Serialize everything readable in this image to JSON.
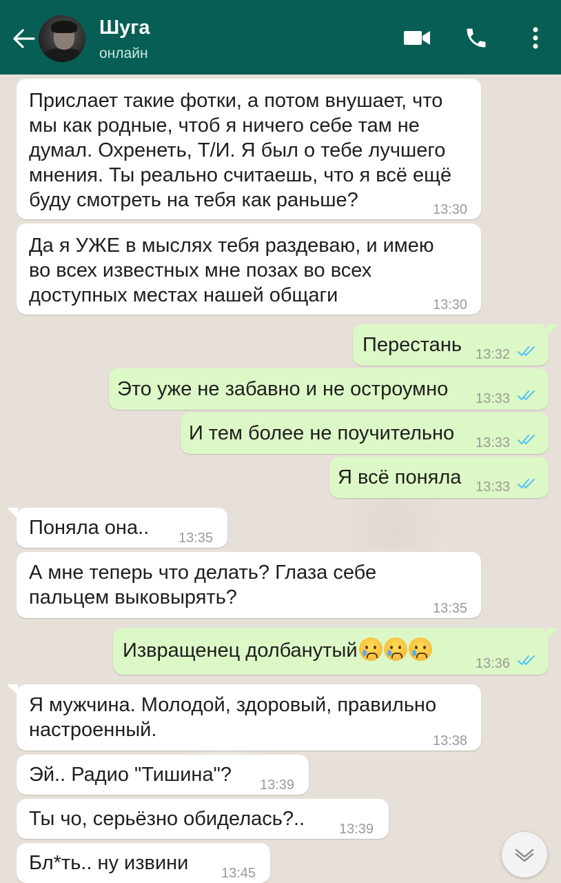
{
  "header": {
    "contact_name": "Шуга",
    "contact_status": "онлайн",
    "bg_color": "#075e54",
    "icons": [
      "back-arrow-icon",
      "video-call-icon",
      "phone-icon",
      "more-vert-icon"
    ]
  },
  "messages": [
    {
      "dir": "in",
      "text": "Прислает такие фотки, а потом внушает, что\nмы как родные, чтоб я ничего себе там не\nдумал. Охренеть, Т/И. Я был о тебе лучшего\nмнения. Ты реально считаешь, что я всё ещё\nбуду смотреть на тебя как раньше?",
      "time": "13:30"
    },
    {
      "dir": "in",
      "text": "Да я УЖЕ в мыслях тебя раздеваю, и имею\nво всех известных мне позах во всех\nдоступных местах нашей общаги",
      "time": "13:30"
    },
    {
      "dir": "out",
      "text": "Перестань",
      "time": "13:32",
      "status": "read"
    },
    {
      "dir": "out",
      "text": "Это уже не забавно и не остроумно",
      "time": "13:33",
      "status": "read"
    },
    {
      "dir": "out",
      "text": "И тем более не поучительно",
      "time": "13:33",
      "status": "read"
    },
    {
      "dir": "out",
      "text": "Я всё поняла",
      "time": "13:33",
      "status": "read"
    },
    {
      "dir": "in",
      "text": "Поняла она..",
      "time": "13:35"
    },
    {
      "dir": "in",
      "text": "А мне теперь что делать? Глаза себе\nпальцем выковырять?",
      "time": "13:35"
    },
    {
      "dir": "out",
      "text": "Извращенец долбанутый",
      "emoji": [
        "crying-face-emoji",
        "crying-face-emoji",
        "crying-face-emoji"
      ],
      "time": "13:36",
      "status": "read"
    },
    {
      "dir": "in",
      "text": "Я мужчина. Молодой, здоровый, правильно\nнастроенный.",
      "time": "13:38"
    },
    {
      "dir": "in",
      "text": "Эй.. Радио \"Тишина\"?",
      "time": "13:39"
    },
    {
      "dir": "in",
      "text": "Ты чо, серьёзно обиделась?..",
      "time": "13:39"
    },
    {
      "dir": "in",
      "text": "Бл*ть.. ну извини",
      "time": "13:45"
    }
  ],
  "colors": {
    "incoming_bubble": "#ffffff",
    "outgoing_bubble": "#dcf8c6",
    "read_ticks": "#4fc3f7",
    "chat_background": "#e6e0d8"
  }
}
